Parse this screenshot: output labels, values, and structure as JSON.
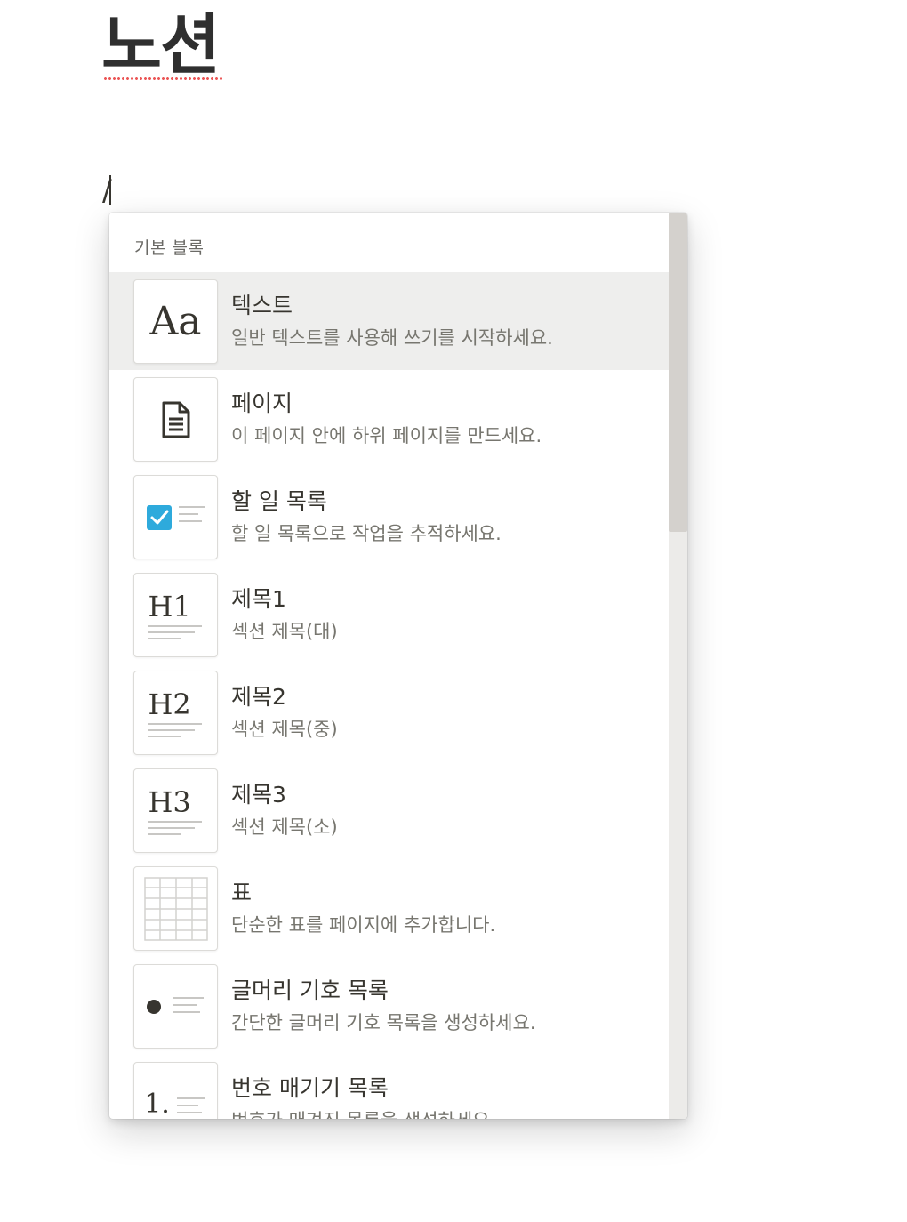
{
  "page": {
    "title": "노션",
    "slash_input": "/"
  },
  "menu": {
    "section_header": "기본 블록",
    "items": [
      {
        "title": "텍스트",
        "description": "일반 텍스트를 사용해 쓰기를 시작하세요.",
        "icon": "text-aa-icon",
        "icon_text": "Aa",
        "active": true
      },
      {
        "title": "페이지",
        "description": "이 페이지 안에 하위 페이지를 만드세요.",
        "icon": "page-icon"
      },
      {
        "title": "할 일 목록",
        "description": "할 일 목록으로 작업을 추적하세요.",
        "icon": "checkbox-icon"
      },
      {
        "title": "제목1",
        "description": "섹션 제목(대)",
        "icon": "heading1-icon",
        "icon_text": "H1"
      },
      {
        "title": "제목2",
        "description": "섹션 제목(중)",
        "icon": "heading2-icon",
        "icon_text": "H2"
      },
      {
        "title": "제목3",
        "description": "섹션 제목(소)",
        "icon": "heading3-icon",
        "icon_text": "H3"
      },
      {
        "title": "표",
        "description": "단순한 표를 페이지에 추가합니다.",
        "icon": "table-icon"
      },
      {
        "title": "글머리 기호 목록",
        "description": "간단한 글머리 기호 목록을 생성하세요.",
        "icon": "bulleted-list-icon"
      },
      {
        "title": "번호 매기기 목록",
        "description": "번호가 매겨진 목록을 생성하세요.",
        "icon": "numbered-list-icon",
        "icon_text": "1."
      }
    ]
  },
  "colors": {
    "accent_checkbox": "#2eaadc",
    "spellcheck_underline": "#eb5757",
    "active_row": "#eeeeed"
  }
}
